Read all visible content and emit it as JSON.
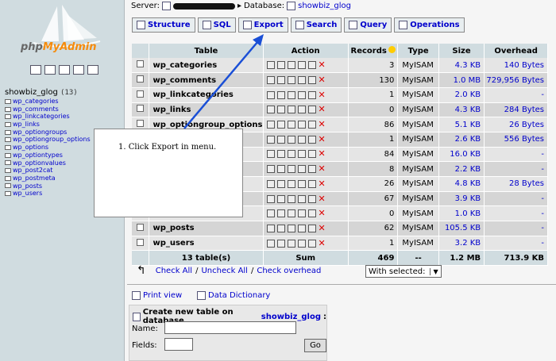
{
  "sidebar": {
    "logo_text_1": "php",
    "logo_text_2": "MyAdmin",
    "db_name": "showbiz_glog",
    "db_count": "(13)",
    "tables": [
      "wp_categories",
      "wp_comments",
      "wp_linkcategories",
      "wp_links",
      "wp_optiongroups",
      "wp_optiongroup_options",
      "wp_options",
      "wp_optiontypes",
      "wp_optionvalues",
      "wp_post2cat",
      "wp_postmeta",
      "wp_posts",
      "wp_users"
    ]
  },
  "header": {
    "server_label": "Server:",
    "database_label": "Database:",
    "database_name": "showbiz_glog"
  },
  "tabs": [
    {
      "label": "Structure",
      "icon": "structure-icon"
    },
    {
      "label": "SQL",
      "icon": "sql-icon"
    },
    {
      "label": "Export",
      "icon": "export-icon"
    },
    {
      "label": "Search",
      "icon": "search-icon"
    },
    {
      "label": "Query",
      "icon": "query-icon"
    },
    {
      "label": "Operations",
      "icon": "operations-icon"
    }
  ],
  "table": {
    "headers": {
      "table": "Table",
      "action": "Action",
      "records": "Records",
      "type": "Type",
      "size": "Size",
      "overhead": "Overhead"
    },
    "rows": [
      {
        "name": "wp_categories",
        "records": "3",
        "type": "MyISAM",
        "size": "4.3 KB",
        "overhead": "140 Bytes"
      },
      {
        "name": "wp_comments",
        "records": "130",
        "type": "MyISAM",
        "size": "1.0 MB",
        "overhead": "729,956 Bytes"
      },
      {
        "name": "wp_linkcategories",
        "records": "1",
        "type": "MyISAM",
        "size": "2.0 KB",
        "overhead": "-"
      },
      {
        "name": "wp_links",
        "records": "0",
        "type": "MyISAM",
        "size": "4.3 KB",
        "overhead": "284 Bytes"
      },
      {
        "name": "wp_optiongroup_options",
        "records": "86",
        "type": "MyISAM",
        "size": "5.1 KB",
        "overhead": "26 Bytes"
      },
      {
        "name": "",
        "records": "1",
        "type": "MyISAM",
        "size": "2.6 KB",
        "overhead": "556 Bytes"
      },
      {
        "name": "",
        "records": "84",
        "type": "MyISAM",
        "size": "16.0 KB",
        "overhead": "-"
      },
      {
        "name": "",
        "records": "8",
        "type": "MyISAM",
        "size": "2.2 KB",
        "overhead": "-"
      },
      {
        "name": "",
        "records": "26",
        "type": "MyISAM",
        "size": "4.8 KB",
        "overhead": "28 Bytes"
      },
      {
        "name": "",
        "records": "67",
        "type": "MyISAM",
        "size": "3.9 KB",
        "overhead": "-"
      },
      {
        "name": "",
        "records": "0",
        "type": "MyISAM",
        "size": "1.0 KB",
        "overhead": "-"
      },
      {
        "name": "wp_posts",
        "records": "62",
        "type": "MyISAM",
        "size": "105.5 KB",
        "overhead": "-"
      },
      {
        "name": "wp_users",
        "records": "1",
        "type": "MyISAM",
        "size": "3.2 KB",
        "overhead": "-"
      }
    ],
    "footer": {
      "count": "13 table(s)",
      "sum": "Sum",
      "records": "469",
      "type": "--",
      "size": "1.2 MB",
      "overhead": "713.9 KB"
    }
  },
  "links": {
    "check_all": "Check All",
    "uncheck_all": "Uncheck All",
    "separator": "/",
    "check_overhead": "Check overhead",
    "with_selected": "With selected:",
    "print_view": "Print view",
    "data_dictionary": "Data Dictionary"
  },
  "create": {
    "title": "Create new table on database",
    "db": "showbiz_glog",
    "colon": ":",
    "name_label": "Name:",
    "fields_label": "Fields:",
    "go": "Go"
  },
  "callout": {
    "text": "1. Click Export in menu."
  },
  "colors": {
    "sidebar_bg": "#d0dce0",
    "link": "#0000cc",
    "arrow": "#1a4fd6"
  }
}
